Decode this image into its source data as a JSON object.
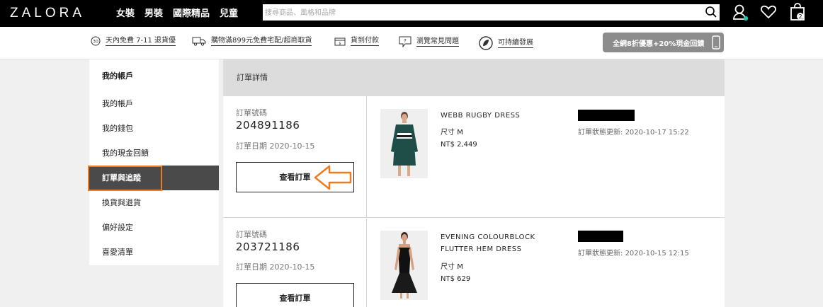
{
  "brand": "ZALORA",
  "nav": [
    "女裝",
    "男裝",
    "國際精品",
    "兒童"
  ],
  "search": {
    "placeholder": "搜尋商品、風格和品牌"
  },
  "cart_count": "2",
  "promos": [
    {
      "icon": "return-30-icon",
      "text": "天內免費 7-11 退貨優"
    },
    {
      "icon": "truck-icon",
      "text": "購物滿899元免費宅配/超商取貨"
    },
    {
      "icon": "cash-icon",
      "text": "貨到付款"
    },
    {
      "icon": "faq-icon",
      "text": "瀏覽常見問題"
    },
    {
      "icon": "leaf-icon",
      "text": "可持續發展"
    }
  ],
  "promo_button": "全網8折優惠+20%現金回饋",
  "sidebar": {
    "title": "我的帳戶",
    "items": [
      "我的帳戶",
      "我的錢包",
      "我的現金回饋",
      "訂單與追蹤",
      "換貨與退貨",
      "偏好設定",
      "喜愛清單"
    ],
    "active_index": 3
  },
  "main": {
    "header": "訂單詳情",
    "order_no_label": "訂單號碼",
    "view_label": "查看訂單",
    "size_label": "尺寸",
    "status_label": "訂單狀態更新:",
    "orders": [
      {
        "number": "204891186",
        "date": "訂單日期 2020-10-15",
        "product_lines": [
          "WEBB RUGBY DRESS"
        ],
        "size": "M",
        "price": "NT$ 2,449",
        "status_time": "2020-10-17 15:22"
      },
      {
        "number": "203721186",
        "date": "訂單日期 2020-10-15",
        "product_lines": [
          "EVENING COLOURBLOCK",
          "FLUTTER HEM DRESS"
        ],
        "size": "M",
        "price": "NT$ 629",
        "status_time": "2020-10-15 12:15"
      }
    ]
  },
  "colors": {
    "accent_orange": "#f07a1f",
    "nav_bg": "#000000",
    "active_bg": "#4a4a4a"
  }
}
